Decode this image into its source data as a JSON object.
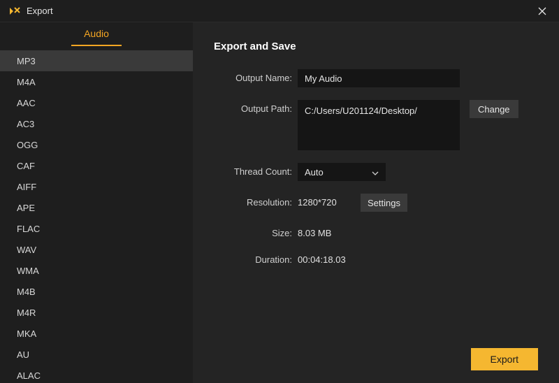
{
  "window": {
    "title": "Export",
    "close_icon": "close"
  },
  "sidebar": {
    "tab_label": "Audio",
    "selected_index": 0,
    "formats": [
      "MP3",
      "M4A",
      "AAC",
      "AC3",
      "OGG",
      "CAF",
      "AIFF",
      "APE",
      "FLAC",
      "WAV",
      "WMA",
      "M4B",
      "M4R",
      "MKA",
      "AU",
      "ALAC"
    ]
  },
  "main": {
    "heading": "Export and Save",
    "labels": {
      "output_name": "Output Name:",
      "output_path": "Output Path:",
      "thread_count": "Thread Count:",
      "resolution": "Resolution:",
      "size": "Size:",
      "duration": "Duration:"
    },
    "values": {
      "output_name": "My Audio",
      "output_path": "C:/Users/U201124/Desktop/",
      "thread_count": "Auto",
      "resolution": "1280*720",
      "size": "8.03 MB",
      "duration": "00:04:18.03"
    },
    "buttons": {
      "change": "Change",
      "settings": "Settings",
      "export": "Export"
    }
  },
  "colors": {
    "accent": "#f5b730",
    "bg_dark": "#1e1e1e",
    "bg_panel": "#242424",
    "input_bg": "#151515"
  }
}
